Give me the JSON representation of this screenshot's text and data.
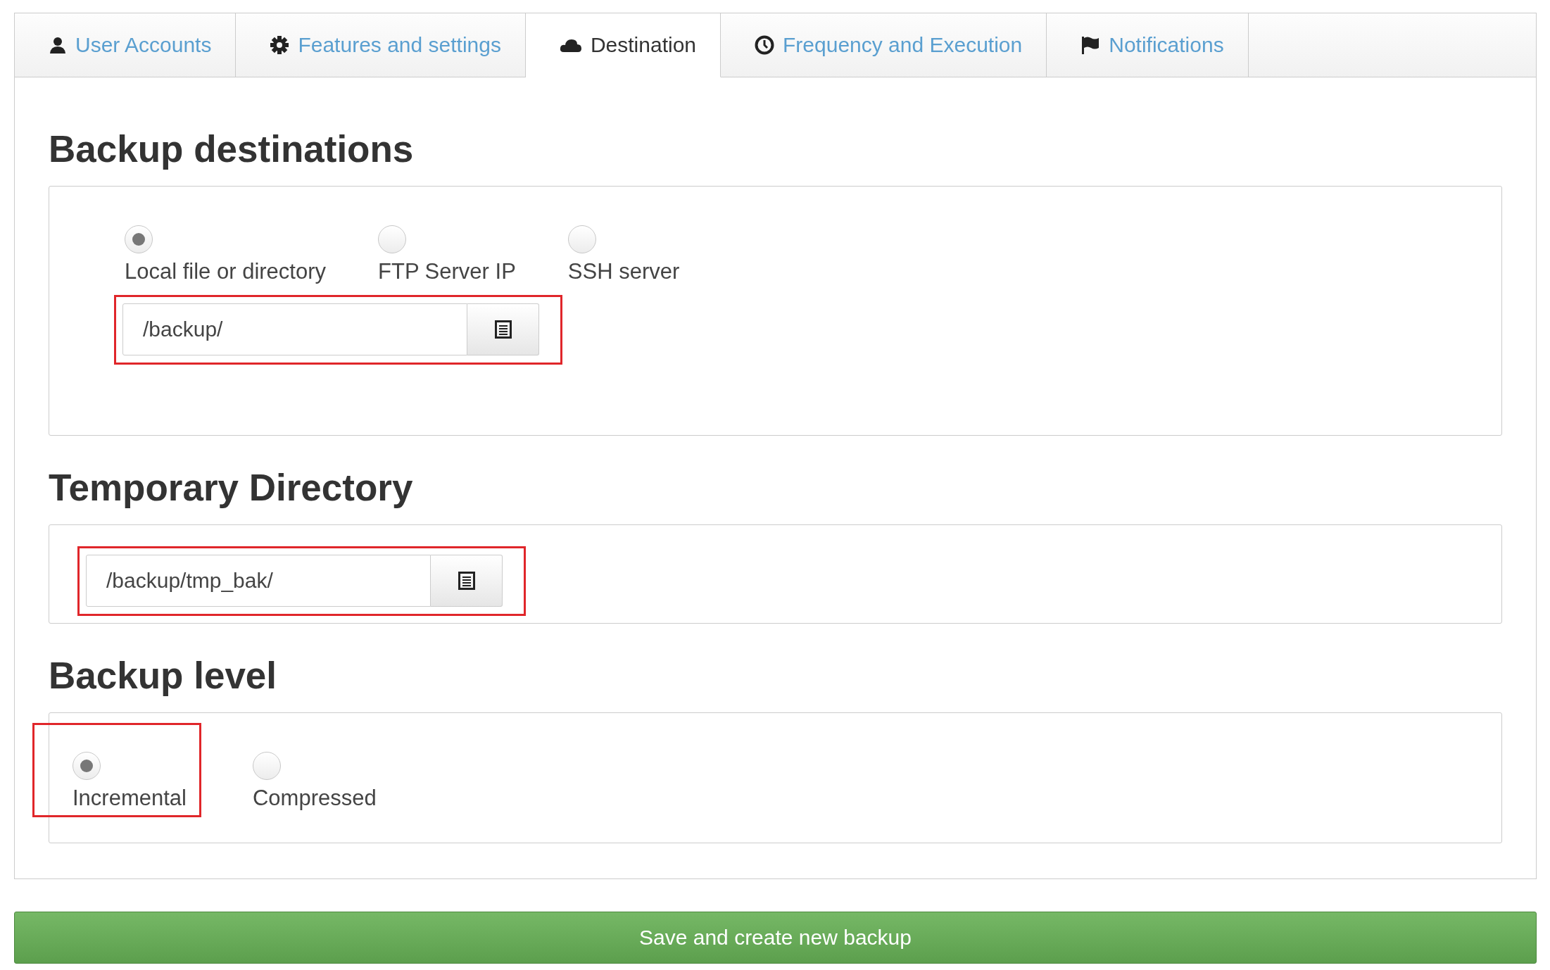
{
  "tabs": [
    {
      "label": "User Accounts",
      "kind": "user",
      "selected": false
    },
    {
      "label": "Features and settings",
      "kind": "gear",
      "selected": false
    },
    {
      "label": "Destination",
      "kind": "cloud",
      "selected": true
    },
    {
      "label": "Frequency and Execution",
      "kind": "clock",
      "selected": false
    },
    {
      "label": "Notifications",
      "kind": "flag",
      "selected": false
    }
  ],
  "sections": [
    {
      "kind": "options_field",
      "heading": "Backup destinations",
      "options": [
        {
          "label": "Local file or directory",
          "selected": true,
          "highlighted": false
        },
        {
          "label": "FTP Server IP",
          "selected": false,
          "highlighted": false
        },
        {
          "label": "SSH server",
          "selected": false,
          "highlighted": false
        }
      ],
      "field": {
        "value": "/backup/",
        "highlighted": true
      }
    },
    {
      "kind": "field",
      "heading": "Temporary Directory",
      "field": {
        "value": "/backup/tmp_bak/",
        "highlighted": true
      }
    },
    {
      "kind": "options",
      "heading": "Backup level",
      "options": [
        {
          "label": "Incremental",
          "selected": true,
          "highlighted": true
        },
        {
          "label": "Compressed",
          "selected": false,
          "highlighted": false
        }
      ]
    }
  ],
  "save_button": "Save and create new backup"
}
